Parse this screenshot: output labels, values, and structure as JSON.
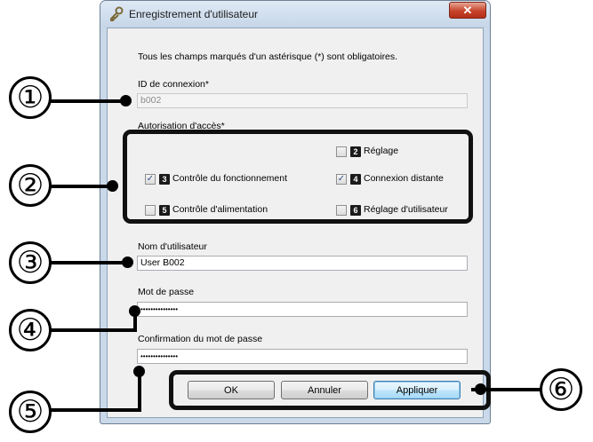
{
  "window": {
    "title": "Enregistrement d'utilisateur",
    "close_glyph": "✕"
  },
  "form": {
    "required_note": "Tous les champs marqués d'un astérisque (*) sont obligatoires.",
    "login_id_label": "ID de connexion*",
    "login_id_value": "b002",
    "access_label": "Autorisation d'accès*",
    "permissions": [
      {
        "num": "2",
        "label": "Réglage",
        "checked": false
      },
      {
        "num": "3",
        "label": "Contrôle du fonctionnement",
        "checked": true
      },
      {
        "num": "4",
        "label": "Connexion distante",
        "checked": true
      },
      {
        "num": "5",
        "label": "Contrôle d'alimentation",
        "checked": false
      },
      {
        "num": "6",
        "label": "Réglage d'utilisateur",
        "checked": false
      }
    ],
    "username_label": "Nom d'utilisateur",
    "username_value": "User B002",
    "password_label": "Mot de passe",
    "password_value": "•••••••••••••••",
    "confirm_label": "Confirmation du mot de passe",
    "confirm_value": "•••••••••••••••"
  },
  "buttons": {
    "ok": "OK",
    "cancel": "Annuler",
    "apply": "Appliquer"
  },
  "callouts": [
    "①",
    "②",
    "③",
    "④",
    "⑤",
    "⑥"
  ],
  "check_glyph": "✓",
  "icons": {
    "app": "key-icon",
    "close": "close-icon"
  }
}
